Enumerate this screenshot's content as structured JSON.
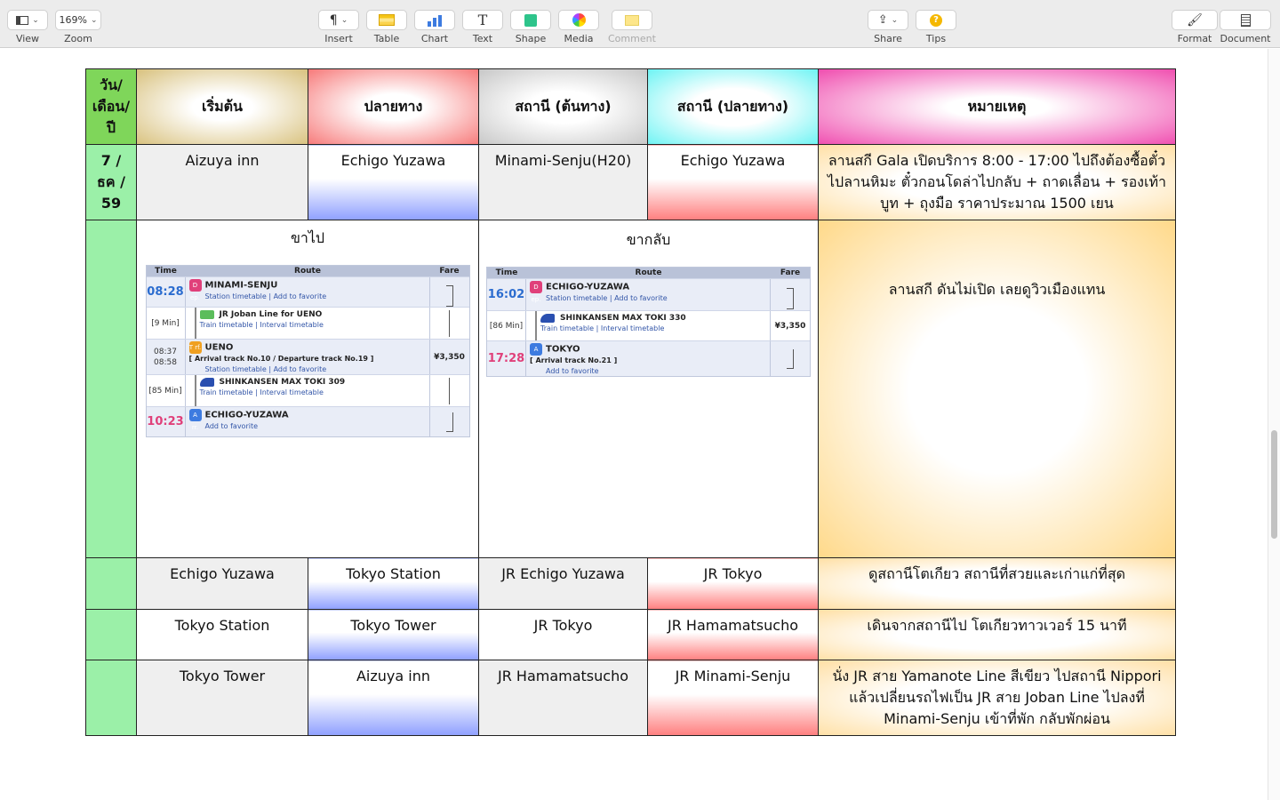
{
  "toolbar": {
    "view": "View",
    "zoom_value": "169%",
    "zoom": "Zoom",
    "insert": "Insert",
    "table": "Table",
    "chart": "Chart",
    "text": "Text",
    "shape": "Shape",
    "media": "Media",
    "comment": "Comment",
    "share": "Share",
    "tips": "Tips",
    "format": "Format",
    "document": "Document"
  },
  "header": {
    "date": "วัน/ เดือน/ ปี",
    "start": "เริ่มต้น",
    "end": "ปลายทาง",
    "st_from": "สถานี (ต้นทาง)",
    "st_to": "สถานี (ปลายทาง)",
    "note": "หมายเหตุ"
  },
  "rows": [
    {
      "date": "7 / ธค / 59",
      "start": "Aizuya inn",
      "end": "Echigo Yuzawa",
      "st_from": "Minami-Senju(H20)",
      "st_to": "Echigo Yuzawa",
      "note": "ลานสกี Gala เปิดบริการ 8:00 - 17:00 ไปถึงต้องซื้อตั๋วไปลานหิมะ ตั๋วกอนโดล่าไปกลับ + ถาดเลื่อน + รองเท้าบูท + ถุงมือ ราคาประมาณ 1500 เยน"
    },
    {
      "date": "",
      "start": "Echigo Yuzawa",
      "end": "Tokyo Station",
      "st_from": "JR  Echigo Yuzawa",
      "st_to": "JR Tokyo",
      "note": "ดูสถานีโตเกียว สถานีที่สวยและเก่าแก่ที่สุด"
    },
    {
      "date": "",
      "start": "Tokyo Station",
      "end": "Tokyo Tower",
      "st_from": "JR Tokyo",
      "st_to": "JR Hamamatsucho",
      "note": "เดินจากสถานีไป โตเกียวทาวเวอร์ 15 นาที"
    },
    {
      "date": "",
      "start": "Tokyo Tower",
      "end": "Aizuya inn",
      "st_from": "JR Hamamatsucho",
      "st_to": "JR Minami-Senju",
      "note": "นั่ง JR สาย Yamanote Line สีเขียว ไปสถานี Nippori แล้วเปลี่ยนรถไฟเป็น JR สาย Joban Line ไปลงที่ Minami-Senju เข้าที่พัก กลับพักผ่อน"
    }
  ],
  "big_row": {
    "go_title": "ขาไป",
    "back_title": "ขากลับ",
    "note": "ลานสกี ดันไม่เปิด เลยดูวิวเมืองแทน",
    "cols": {
      "time": "Time",
      "route": "Route",
      "fare": "Fare"
    },
    "go": {
      "t1": "08:28",
      "st1": "MINAMI-SENJU",
      "st1_links": "Station timetable | Add to favorite",
      "b1": "D ep.",
      "dur1": "[9 Min]",
      "line1": "JR Joban Line  for UENO",
      "line1_links": "Train timetable | Interval timetable",
      "t2a": "08:37",
      "t2b": "08:58",
      "st2": "UENO",
      "st2_track": "[ Arrival track No.10 / Departure track No.19 ]",
      "st2_links": "Station timetable | Add to favorite",
      "b2": "T rf.",
      "fare": "¥3,350",
      "dur2": "[85 Min]",
      "line2": "SHINKANSEN MAX TOKI 309",
      "line2_links": "Train timetable | Interval timetable",
      "t3": "10:23",
      "st3": "ECHIGO-YUZAWA",
      "st3_links": "Add to favorite",
      "b3": "A rr."
    },
    "back": {
      "t1": "16:02",
      "st1": "ECHIGO-YUZAWA",
      "st1_links": "Station timetable | Add to favorite",
      "b1": "D ep.",
      "dur1": "[86 Min]",
      "line1": "SHINKANSEN MAX TOKI 330",
      "line1_links": "Train timetable | Interval timetable",
      "fare": "¥3,350",
      "t2": "17:28",
      "st2": "TOKYO",
      "st2_track": "[ Arrival track No.21 ]",
      "st2_links": "Add to favorite",
      "b2": "A rr."
    }
  }
}
